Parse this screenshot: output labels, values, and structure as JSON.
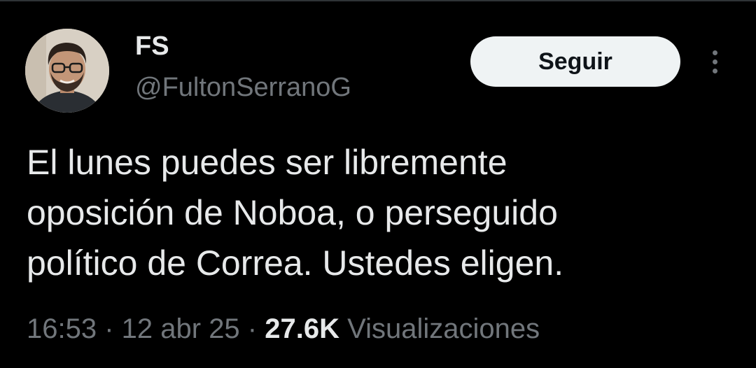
{
  "author": {
    "display_name": "FS",
    "handle": "@FultonSerranoG",
    "avatar_icon": "user-avatar-photo"
  },
  "actions": {
    "follow_label": "Seguir",
    "more_icon": "more-vertical-icon"
  },
  "tweet": {
    "text_lines": [
      "El lunes puedes ser libremente",
      "oposición de Noboa, o perseguido",
      "político de Correa. Ustedes eligen."
    ]
  },
  "meta": {
    "time": "16:53",
    "separator": " · ",
    "date": "12 abr 25",
    "views_count": "27.6K",
    "views_label": "Visualizaciones"
  },
  "colors": {
    "background": "#000000",
    "primary_text": "#e7e9ea",
    "secondary_text": "#71767b",
    "follow_bg": "#eff3f4",
    "follow_text": "#0f1419"
  }
}
